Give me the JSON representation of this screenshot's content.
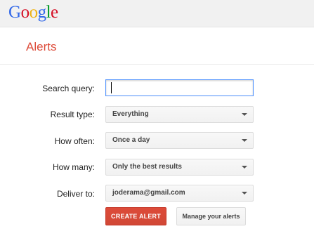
{
  "brand": {
    "letters": [
      "G",
      "o",
      "o",
      "g",
      "l",
      "e"
    ],
    "colors": [
      "#3369e8",
      "#d50f25",
      "#eeb211",
      "#3369e8",
      "#009925",
      "#d50f25"
    ]
  },
  "page": {
    "title": "Alerts"
  },
  "form": {
    "search_label": "Search query:",
    "search_value": "",
    "result_type_label": "Result type:",
    "result_type_value": "Everything",
    "how_often_label": "How often:",
    "how_often_value": "Once a day",
    "how_many_label": "How many:",
    "how_many_value": "Only the best results",
    "deliver_label": "Deliver to:",
    "deliver_value": "joderama@gmail.com"
  },
  "actions": {
    "create_label": "CREATE ALERT",
    "manage_label": "Manage your alerts"
  },
  "colors": {
    "accent": "#dd4b39",
    "focus": "#4d90fe"
  }
}
